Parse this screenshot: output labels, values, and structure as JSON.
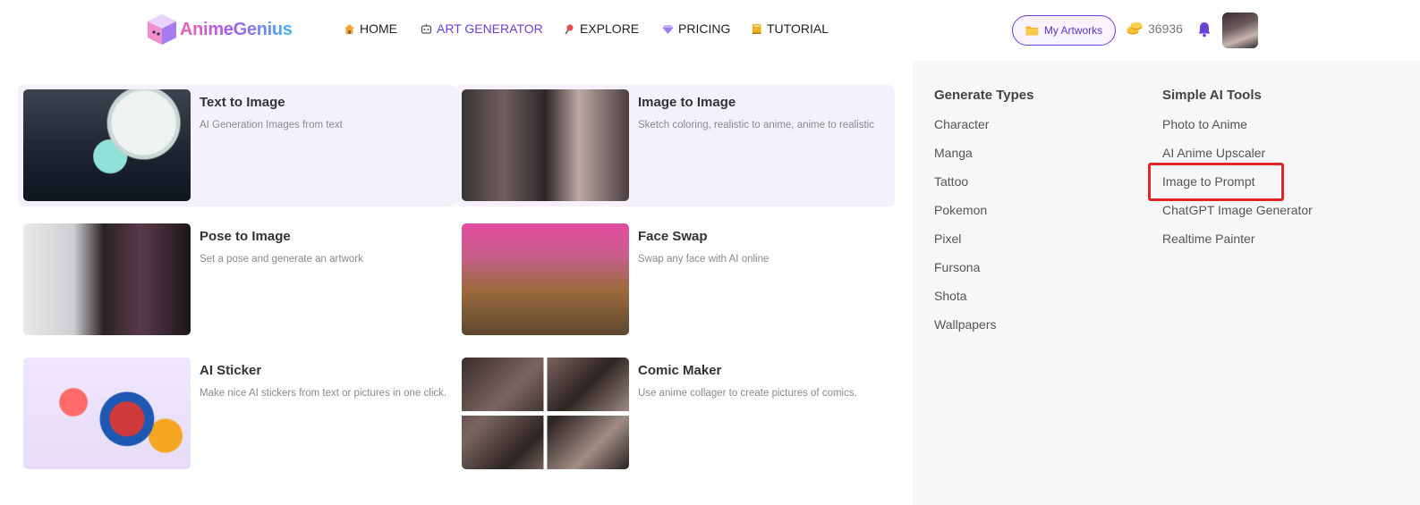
{
  "brand": {
    "name": "AnimeGenius"
  },
  "nav": [
    {
      "label": "HOME",
      "icon": "house-icon"
    },
    {
      "label": "ART GENERATOR",
      "icon": "robot-icon",
      "active": true
    },
    {
      "label": "EXPLORE",
      "icon": "pin-icon"
    },
    {
      "label": "PRICING",
      "icon": "diamond-icon"
    },
    {
      "label": "TUTORIAL",
      "icon": "book-icon"
    }
  ],
  "header": {
    "my_artworks": "My Artworks",
    "coins": "36936"
  },
  "tools": [
    {
      "title": "Text to Image",
      "desc": "AI Generation Images from text"
    },
    {
      "title": "Image to Image",
      "desc": "Sketch coloring, realistic to anime, anime to realistic"
    },
    {
      "title": "Pose to Image",
      "desc": "Set a pose and generate an artwork"
    },
    {
      "title": "Face Swap",
      "desc": "Swap any face with AI online"
    },
    {
      "title": "AI Sticker",
      "desc": "Make nice AI stickers from text or pictures in one click."
    },
    {
      "title": "Comic Maker",
      "desc": "Use anime collager to create pictures of comics."
    }
  ],
  "generate_types": {
    "heading": "Generate Types",
    "items": [
      "Character",
      "Manga",
      "Tattoo",
      "Pokemon",
      "Pixel",
      "Fursona",
      "Shota",
      "Wallpapers"
    ]
  },
  "simple_tools": {
    "heading": "Simple AI Tools",
    "items": [
      "Photo to Anime",
      "AI Anime Upscaler",
      "Image to Prompt",
      "ChatGPT Image Generator",
      "Realtime Painter"
    ]
  },
  "colors": {
    "accent": "#6a40d8",
    "highlight_box": "#e32424",
    "coin": "#f2b01e"
  }
}
